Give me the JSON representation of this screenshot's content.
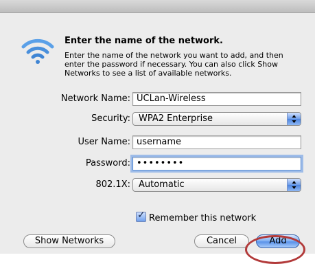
{
  "dialog": {
    "heading": "Enter the name of the network.",
    "description_lines": [
      "Enter the name of the network you want to add, and then",
      "enter the password if necessary. You can also click Show",
      "Networks to see a list of available networks."
    ],
    "icon": "wifi-icon"
  },
  "form": {
    "network_name_label": "Network Name:",
    "network_name_value": "UCLan-Wireless",
    "security_label": "Security:",
    "security_value": "WPA2 Enterprise",
    "user_name_label": "User Name:",
    "user_name_value": "username",
    "password_label": "Password:",
    "password_value": "••••••••",
    "eap_label": "802.1X:",
    "eap_value": "Automatic",
    "remember_label": "Remember this network",
    "remember_checked": true
  },
  "buttons": {
    "show_networks": "Show Networks",
    "cancel": "Cancel",
    "add": "Add"
  },
  "colors": {
    "focus_ring": "#5f96e6",
    "highlight_circle": "#b23a3a",
    "default_button": "#5b93ea"
  }
}
